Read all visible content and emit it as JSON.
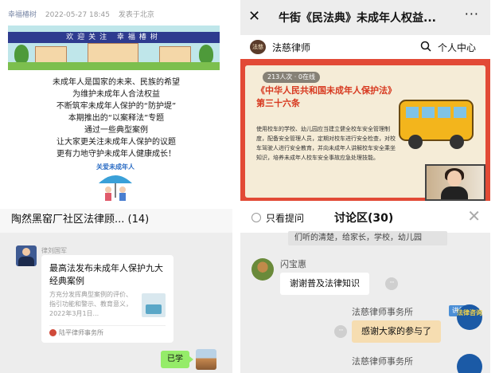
{
  "article": {
    "author": "幸福椿树",
    "date": "2022-05-27 18:45",
    "location": "发表于北京",
    "banner_text": "欢迎关注 幸福椿树",
    "lines": [
      "未成年人是国家的未来、民族的希望",
      "为维护未成年人合法权益",
      "不断筑牢未成年人保护的“防护堤”",
      "本期推出的“以案释法”专题",
      "通过一些典型案例",
      "让大家更关注未成年人保护的议题",
      "更有力地守护未成年人健康成长！"
    ],
    "care_logo_text": "关爱未成年人"
  },
  "group_chat": {
    "title": "陶然黑窑厂社区法律顾... (14)",
    "sender": "律刘国军",
    "card": {
      "title": "最高法发布未成年人保护九大经典案例",
      "desc": "方充分发挥典型案例的评价、指引功能和警示、教育意义，2022年3月1日...",
      "source": "陆平律师事务所"
    },
    "reply": "已学"
  },
  "live": {
    "nav": {
      "close": "✕",
      "title": "牛街《民法典》未成年人权益...",
      "more": "···"
    },
    "account": {
      "logo_text": "法慈",
      "name": "法慈律师",
      "user_center": "个人中心"
    },
    "slide": {
      "badge": "213人次 · 0在线",
      "title": "《中华人民共和国未成年人保护法》第三十六条",
      "body": "使用校车的学校、幼儿园应当建立健全校车安全管理制度，配备安全管理人员，定期对校车进行安全检查，对校车驾驶人进行安全教育，并向未成年人讲解校车安全乘坐知识，培养未成年人校车安全事故应急处理技能。"
    }
  },
  "discussion": {
    "only_ask": "只看提问",
    "title": "讨论区(30)",
    "close": "✕",
    "cutoff_message": "们听的清楚，给家长，学校，幼儿园",
    "messages": [
      {
        "name": "闪宝惠",
        "text": "谢谢普及法律知识"
      },
      {
        "name": "法慈律师事务所",
        "tag": "讲师",
        "avatar_text": "法律咨询",
        "text": "感谢大家的参与了"
      },
      {
        "name": "法慈律师事务所"
      }
    ],
    "more_dots": "···"
  },
  "colors": {
    "wechat_green": "#95ec69",
    "live_red": "#e24a36",
    "slide_title_red": "#d7381f",
    "lecturer_blue": "#4c8fd6",
    "reply_bubble": "#f6ddb1"
  },
  "icons": {
    "close": "close-icon",
    "more": "more-icon",
    "search": "search-icon"
  }
}
